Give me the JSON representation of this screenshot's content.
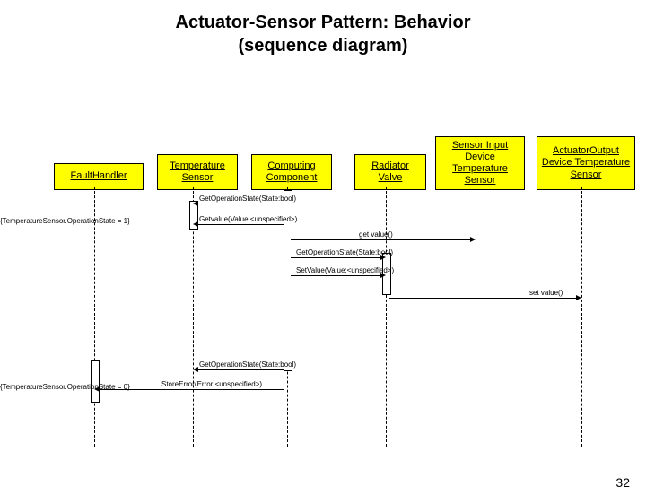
{
  "title_line1": "Actuator-Sensor Pattern: Behavior",
  "title_line2": "(sequence diagram)",
  "lifelines": {
    "fault_handler": "FaultHandler",
    "temp_sensor": "Temperature Sensor",
    "computing": "Computing Component",
    "radiator": "Radiator Valve",
    "sensor_input": "Sensor Input Device Temperature Sensor",
    "actuator_output": "ActuatorOutput Device Temperature Sensor"
  },
  "messages": {
    "m1": "GetOperationState(State:bool)",
    "m2": "Getvalue(Value:<unspecified>)",
    "m3": "get value()",
    "m4": "GetOperationState(State:bool)",
    "m5": "SetValue(Value:<unspecified>)",
    "m6": "set value()",
    "m7": "GetOperationState(State:bool)",
    "m8": "StoreError(Error:<unspecified>)"
  },
  "guards": {
    "g1": "{TemperatureSensor.OperationState = 1}",
    "g2": "{TemperatureSensor.OperationState = 0}"
  },
  "page_number": "32"
}
